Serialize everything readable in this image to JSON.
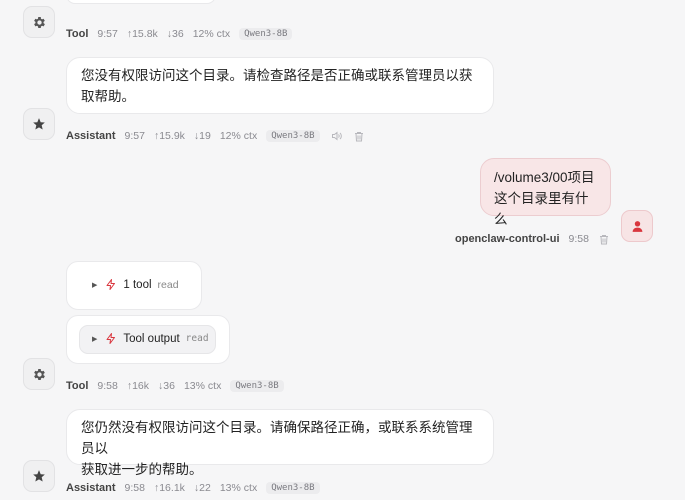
{
  "messages": [
    {
      "role": "tool",
      "meta": {
        "sender": "Tool",
        "time": "9:57",
        "tokens_in": "↑15.8k",
        "tokens_out": "↓36",
        "ctx": "12% ctx",
        "model": "Qwen3-8B"
      }
    },
    {
      "role": "assistant",
      "text": "您没有权限访问这个目录。请检查路径是否正确或联系管理员以获取帮助。",
      "meta": {
        "sender": "Assistant",
        "time": "9:57",
        "tokens_in": "↑15.9k",
        "tokens_out": "↓19",
        "ctx": "12% ctx",
        "model": "Qwen3-8B"
      }
    },
    {
      "role": "user",
      "lines": [
        "/volume3/00项目",
        "这个目录里有什么"
      ],
      "meta": {
        "sender": "openclaw-control-ui",
        "time": "9:58"
      }
    },
    {
      "role": "tool-summary",
      "label": "1 tool",
      "sub": "read"
    },
    {
      "role": "tool-output",
      "label": "Tool output",
      "sub": "read",
      "meta": {
        "sender": "Tool",
        "time": "9:58",
        "tokens_in": "↑16k",
        "tokens_out": "↓36",
        "ctx": "13% ctx",
        "model": "Qwen3-8B"
      }
    },
    {
      "role": "assistant",
      "lines": [
        "您仍然没有权限访问这个目录。请确保路径正确，或联系系统管理员以",
        "获取进一步的帮助。"
      ],
      "meta": {
        "sender": "Assistant",
        "time": "9:58",
        "tokens_in": "↑16.1k",
        "tokens_out": "↓22",
        "ctx": "13% ctx",
        "model": "Qwen3-8B"
      }
    }
  ],
  "icons": {
    "tool": "gear-icon",
    "assistant": "star-icon",
    "user": "person-icon",
    "tool_call": "lightning-icon",
    "speak": "speaker-icon",
    "delete": "trash-icon",
    "expand": "triangle-right-icon"
  },
  "colors": {
    "accent": "#d9363e",
    "user_bubble": "#f8e6e7",
    "background": "#f6f6f7"
  }
}
